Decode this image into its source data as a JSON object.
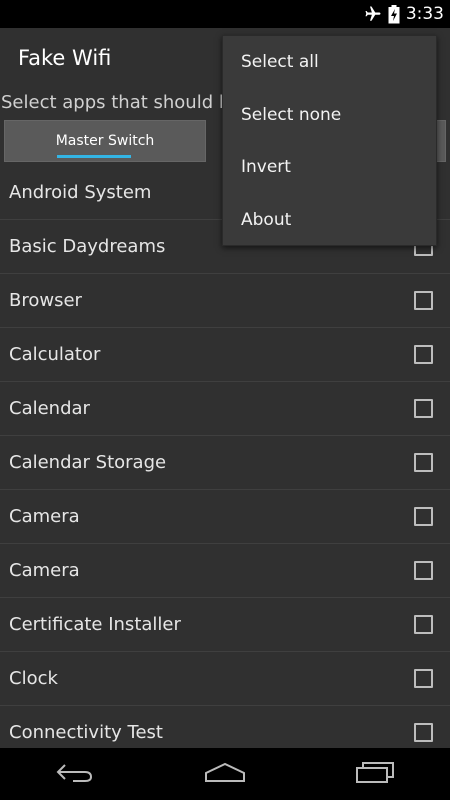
{
  "status_bar": {
    "time": "3:33",
    "icons": [
      "airplane-mode-icon",
      "battery-charging-icon"
    ]
  },
  "action_bar": {
    "title": "Fake Wifi"
  },
  "instruction": "Select apps that should b",
  "switches": {
    "master_label": "Master Switch"
  },
  "apps": [
    {
      "label": "Android System",
      "checked": false
    },
    {
      "label": "Basic Daydreams",
      "checked": false
    },
    {
      "label": "Browser",
      "checked": false
    },
    {
      "label": "Calculator",
      "checked": false
    },
    {
      "label": "Calendar",
      "checked": false
    },
    {
      "label": "Calendar Storage",
      "checked": false
    },
    {
      "label": "Camera",
      "checked": false
    },
    {
      "label": "Camera",
      "checked": false
    },
    {
      "label": "Certificate Installer",
      "checked": false
    },
    {
      "label": "Clock",
      "checked": false
    },
    {
      "label": "Connectivity Test",
      "checked": false
    }
  ],
  "overflow_menu": {
    "items": [
      "Select all",
      "Select none",
      "Invert",
      "About"
    ]
  },
  "nav_bar": {
    "icons": [
      "back-icon",
      "home-icon",
      "recent-apps-icon"
    ]
  },
  "colors": {
    "accent": "#33b5e5",
    "background": "#303030",
    "menu_background": "#3a3a3a"
  }
}
